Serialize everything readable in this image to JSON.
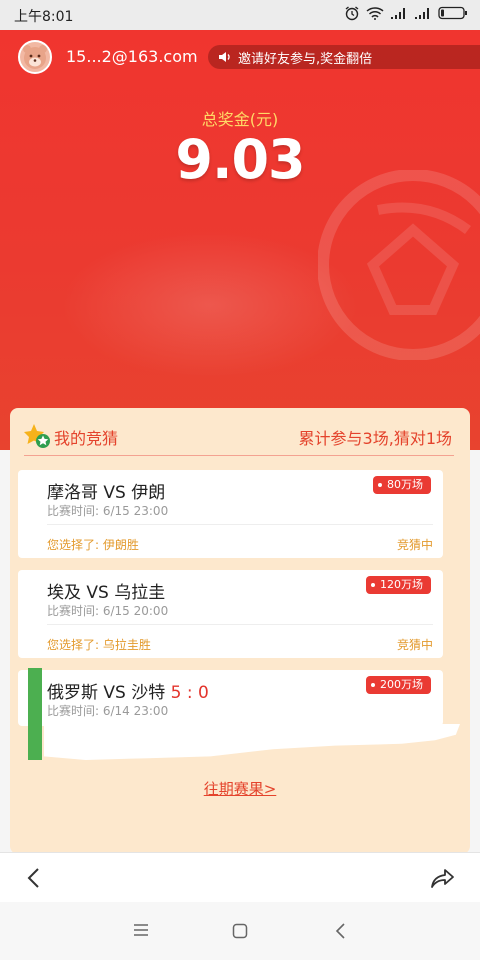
{
  "status_bar": {
    "time": "上午8:01",
    "icons": [
      "alarm-icon",
      "wifi-icon",
      "signal-icon",
      "signal-icon",
      "battery-icon"
    ]
  },
  "header": {
    "account": "15...2@163.com",
    "invite_text": "邀请好友参与,奖金翻倍",
    "total_label": "总奖金(元)",
    "total_value": "9.03"
  },
  "panel": {
    "title": "我的竞猜",
    "summary": "累计参与3场,猜对1场",
    "matches": [
      {
        "name": "摩洛哥 VS 伊朗",
        "time": "比赛时间: 6/15 23:00",
        "badge": "80万场",
        "choice": "您选择了: 伊朗胜",
        "status": "竞猜中"
      },
      {
        "name": "埃及 VS 乌拉圭",
        "time": "比赛时间: 6/15 20:00",
        "badge": "120万场",
        "choice": "您选择了: 乌拉圭胜",
        "status": "竞猜中"
      },
      {
        "name": "俄罗斯 VS 沙特",
        "score": "5 : 0",
        "time": "比赛时间: 6/14 23:00",
        "badge": "200万场"
      }
    ],
    "past_link": "往期赛果>"
  },
  "colors": {
    "primary_red": "#eb3a30",
    "accent_gold": "#ffd966",
    "panel_bg": "#fde8cd",
    "orange_text": "#e39a2d"
  }
}
